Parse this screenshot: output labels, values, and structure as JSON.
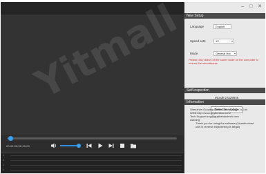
{
  "player": {
    "time_display": "00:00:00/00:00:00",
    "seek_progress": 0.03,
    "volume_level": 0.85
  },
  "waveform": {
    "labels": [
      "4",
      "3",
      "2",
      "1"
    ]
  },
  "window_controls": "– □ ✕",
  "settings": {
    "title": "New Setup",
    "language_label": "Language",
    "language_value": "English",
    "speed_label": "Speed setti",
    "speed_value": "1X",
    "mode_label": "Mode",
    "mode_value": "General Hot",
    "note": "Please play videos of the same mode on the computer to ensure the smoothness"
  },
  "self_check": {
    "title": "Self-inspection",
    "machine_code": "Mcode:zza29648",
    "detect_button": "Detection Update"
  },
  "information": {
    "title": "Information",
    "lines": [
      "Shenzhen Guoying Beidou Technology Co.,Ltd",
      "WEB:http://www.guyibeidou.com/",
      "Tech Support:zzg@guyibeidoutech.com",
      "warning:",
      "Thank you for using the software (Unauthorized",
      "use or reverse engineering is illegal)"
    ]
  },
  "watermark": "Yitmall",
  "colors": {
    "accent": "#2f8fe0",
    "panel_bg": "#e9e9e9",
    "header_bg": "#4a4a4a",
    "warning": "#d03030"
  }
}
